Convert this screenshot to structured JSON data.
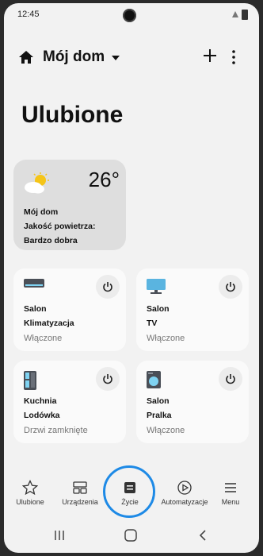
{
  "status_bar": {
    "time": "12:45"
  },
  "header": {
    "home_title": "Mój dom"
  },
  "page": {
    "title": "Ulubione"
  },
  "weather": {
    "temperature": "26°",
    "location": "Mój dom",
    "air_quality_label": "Jakość powietrza:",
    "air_quality_value": "Bardzo dobra"
  },
  "devices": [
    {
      "room": "Salon",
      "name": "Klimatyzacja",
      "status": "Włączone",
      "icon": "air-conditioner-icon"
    },
    {
      "room": "Salon",
      "name": "TV",
      "status": "Włączone",
      "icon": "tv-icon"
    },
    {
      "room": "Kuchnia",
      "name": "Lodówka",
      "status": "Drzwi zamknięte",
      "icon": "fridge-icon"
    },
    {
      "room": "Salon",
      "name": "Pralka",
      "status": "Włączone",
      "icon": "washing-machine-icon"
    }
  ],
  "bottom_nav": [
    {
      "label": "Ulubione",
      "icon": "star-icon"
    },
    {
      "label": "Urządzenia",
      "icon": "devices-icon"
    },
    {
      "label": "Życie",
      "icon": "life-icon",
      "active": true
    },
    {
      "label": "Automatyzacje",
      "icon": "play-circle-icon"
    },
    {
      "label": "Menu",
      "icon": "menu-icon"
    }
  ],
  "colors": {
    "accent": "#1e8ae6",
    "background": "#f2f2f2",
    "card": "#fafafa",
    "weather_card": "#dedede"
  }
}
